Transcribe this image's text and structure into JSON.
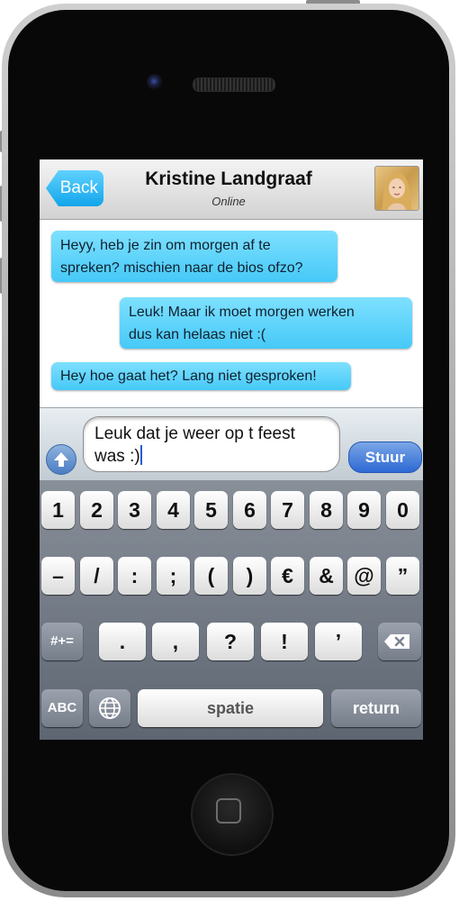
{
  "nav": {
    "back_label": "Back",
    "title": "Kristine Landgraaf",
    "status": "Online",
    "avatar_icon": "contact-photo"
  },
  "messages": [
    {
      "direction": "incoming",
      "lines": [
        "Heyy, heb je zin om morgen af te",
        "spreken? mischien naar de bios ofzo?"
      ]
    },
    {
      "direction": "outgoing",
      "lines": [
        "Leuk! Maar ik moet morgen werken",
        "dus kan helaas niet :("
      ]
    },
    {
      "direction": "incoming",
      "lines": [
        "Hey hoe gaat het? Lang niet gesproken!"
      ]
    }
  ],
  "composer": {
    "input_lines": [
      "Leuk dat je weer op t feest",
      "was :)"
    ],
    "send_label": "Stuur",
    "attach_icon": "arrow-up-icon"
  },
  "keyboard": {
    "row1": [
      "1",
      "2",
      "3",
      "4",
      "5",
      "6",
      "7",
      "8",
      "9",
      "0"
    ],
    "row2": [
      "–",
      "/",
      ":",
      ";",
      "(",
      ")",
      "€",
      "&",
      "@",
      "”"
    ],
    "row3_left": "#+=",
    "row3": [
      ".",
      ",",
      "?",
      "!",
      "’"
    ],
    "row3_right_icon": "backspace-icon",
    "row4_left": "ABC",
    "row4_globe_icon": "globe-icon",
    "space_label": "spatie",
    "return_label": "return"
  },
  "colors": {
    "bubble": "#46c9f7",
    "send": "#2c69d4",
    "back": "#11a5ea"
  }
}
